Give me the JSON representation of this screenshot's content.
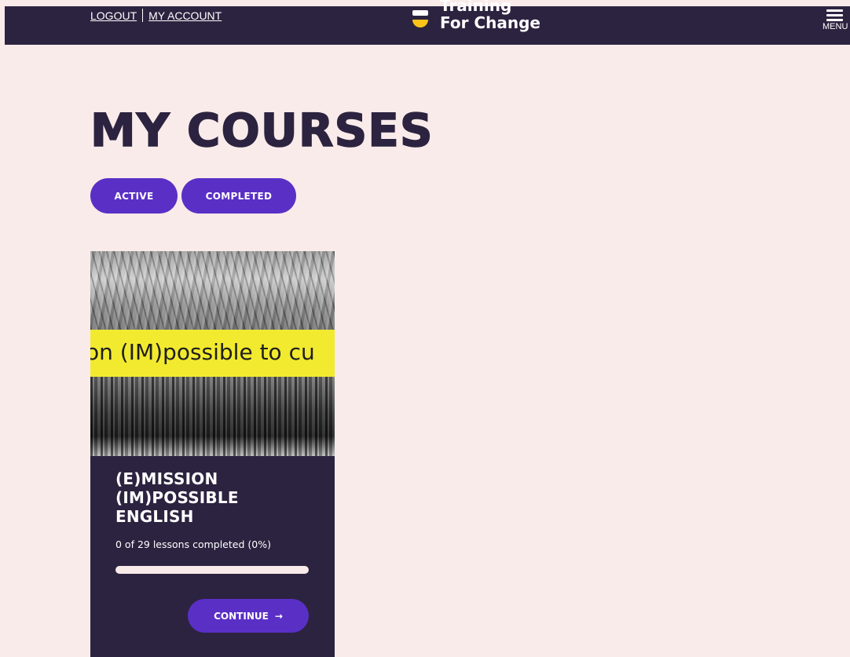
{
  "header": {
    "logout_label": "LOGOUT",
    "account_label": "MY ACCOUNT",
    "logo_line1": "Training",
    "logo_line2": "For Change",
    "menu_label": "MENU"
  },
  "main": {
    "title": "MY COURSES",
    "filters": [
      {
        "label": "ACTIVE"
      },
      {
        "label": "COMPLETED"
      }
    ]
  },
  "course": {
    "image_banner_text": "on (IM)possible to cu",
    "title_lines": [
      "(E)MISSION",
      "(IM)POSSIBLE",
      "ENGLISH"
    ],
    "progress_text": "0 of 29 lessons completed (0%)",
    "progress_fraction": 0,
    "continue_label": "CONTINUE",
    "continue_arrow": "→"
  },
  "colors": {
    "navy": "#2c2340",
    "purple": "#5a2fc6",
    "background": "#f9ebe9",
    "logo_yellow": "#fcc419"
  },
  "icons": {
    "menu": "hamburger-menu-icon",
    "arrow": "arrow-right-icon"
  }
}
